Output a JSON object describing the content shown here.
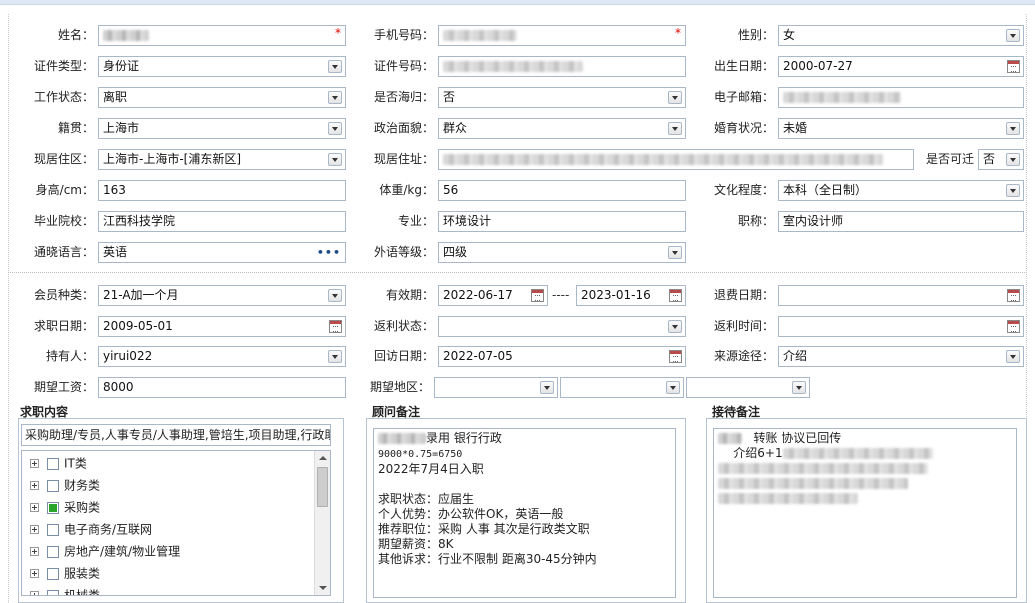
{
  "personal": {
    "name": {
      "label": "姓名："
    },
    "phone": {
      "label": "手机号码："
    },
    "gender": {
      "label": "性别：",
      "value": "女"
    },
    "id_type": {
      "label": "证件类型：",
      "value": "身份证"
    },
    "id_number": {
      "label": "证件号码："
    },
    "birth_date": {
      "label": "出生日期：",
      "value": "2000-07-27"
    },
    "work_status": {
      "label": "工作状态：",
      "value": "离职"
    },
    "overseas": {
      "label": "是否海归：",
      "value": "否"
    },
    "email": {
      "label": "电子邮箱："
    },
    "native_place": {
      "label": "籍贯：",
      "value": "上海市"
    },
    "political": {
      "label": "政治面貌：",
      "value": "群众"
    },
    "marital": {
      "label": "婚育状况：",
      "value": "未婚"
    },
    "current_area": {
      "label": "现居住区：",
      "value": "上海市-上海市-[浦东新区]"
    },
    "current_address": {
      "label": "现居住址："
    },
    "relocate": {
      "label": "是否可迁",
      "value": "否"
    },
    "height": {
      "label": "身高/cm：",
      "value": "163"
    },
    "weight": {
      "label": "体重/kg：",
      "value": "56"
    },
    "education": {
      "label": "文化程度：",
      "value": "本科（全日制）"
    },
    "school": {
      "label": "毕业院校：",
      "value": "江西科技学院"
    },
    "major": {
      "label": "专业：",
      "value": "环境设计"
    },
    "title": {
      "label": "职称：",
      "value": "室内设计师"
    },
    "language": {
      "label": "通晓语言：",
      "value": "英语"
    },
    "foreign_level": {
      "label": "外语等级：",
      "value": "四级"
    }
  },
  "membership": {
    "member_type": {
      "label": "会员种类：",
      "value": "21-A加一个月"
    },
    "valid_period": {
      "label": "有效期：",
      "start": "2022-06-17",
      "separator": "----",
      "end": "2023-01-16"
    },
    "refund_date": {
      "label": "退费日期："
    },
    "job_date": {
      "label": "求职日期：",
      "value": "2009-05-01"
    },
    "rebate_status": {
      "label": "返利状态："
    },
    "rebate_time": {
      "label": "返利时间："
    },
    "holder": {
      "label": "持有人：",
      "value": "yirui022"
    },
    "visit_date": {
      "label": "回访日期：",
      "value": "2022-07-05"
    },
    "source": {
      "label": "来源途径：",
      "value": "介绍"
    },
    "expected_salary": {
      "label": "期望工资：",
      "value": "8000"
    },
    "expected_region": {
      "label": "期望地区："
    }
  },
  "job_content": {
    "title": "求职内容",
    "text": "采购助理/专员,人事专员/人事助理,管培生,项目助理,行政助",
    "categories": [
      {
        "label": "IT类",
        "checked": false
      },
      {
        "label": "财务类",
        "checked": false
      },
      {
        "label": "采购类",
        "checked": true
      },
      {
        "label": "电子商务/互联网",
        "checked": false
      },
      {
        "label": "房地产/建筑/物业管理",
        "checked": false
      },
      {
        "label": "服装类",
        "checked": false
      },
      {
        "label": "机械类",
        "checked": false
      }
    ]
  },
  "advisor_note": {
    "title": "顾问备注",
    "line1": "录用 银行行政",
    "line2": "9000*0.75=6750",
    "line3": "2022年7月4日入职",
    "line4": "求职状态：应届生",
    "line5": "个人优势：办公软件OK，英语一般",
    "line6": "推荐职位：采购 人事 其次是行政类文职",
    "line7": "期望薪资：8K",
    "line8": "其他诉求：行业不限制 距离30-45分钟内"
  },
  "reception_note": {
    "title": "接待备注",
    "line1": "转账 协议已回传",
    "line2": "介绍6+1"
  }
}
